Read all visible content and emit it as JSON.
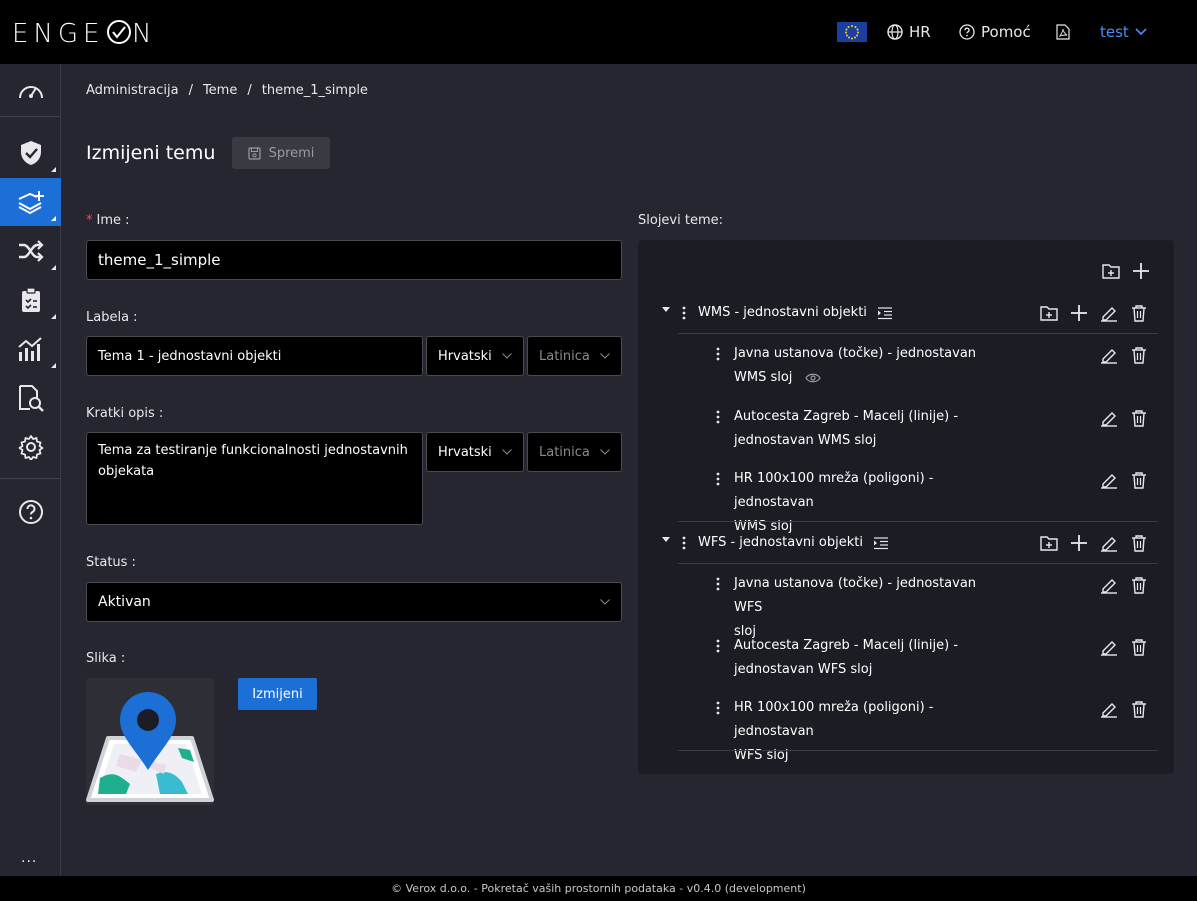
{
  "app": {
    "logo": "ENGE◯N"
  },
  "topbar": {
    "language": "HR",
    "help": "Pomoć",
    "user": "test"
  },
  "breadcrumb": {
    "items": [
      "Administracija",
      "Teme",
      "theme_1_simple"
    ],
    "separator": "/"
  },
  "page": {
    "title": "Izmijeni temu",
    "save_label": "Spremi"
  },
  "form": {
    "name_label": "Ime :",
    "name_required": "*",
    "name_value": "theme_1_simple",
    "label_label": "Labela :",
    "label_value": "Tema 1 - jednostavni objekti",
    "label_language": "Hrvatski",
    "label_script": "Latinica",
    "desc_label": "Kratki opis :",
    "desc_value": "Tema za testiranje funkcionalnosti jednostavnih objekata",
    "desc_language": "Hrvatski",
    "desc_script": "Latinica",
    "status_label": "Status :",
    "status_value": "Aktivan",
    "image_label": "Slika :",
    "image_change": "Izmijeni"
  },
  "layers": {
    "title": "Slojevi teme:",
    "groups": [
      {
        "title": "WMS - jednostavni objekti",
        "items": [
          {
            "line1": "Javna ustanova (točke) - jednostavan",
            "line2": "WMS sloj"
          },
          {
            "line1": "Autocesta Zagreb - Macelj (linije) -",
            "line2": "jednostavan WMS sloj"
          },
          {
            "line1": "HR 100x100 mreža (poligoni) - jednostavan",
            "line2": "WMS sloj"
          }
        ]
      },
      {
        "title": "WFS - jednostavni objekti",
        "items": [
          {
            "line1": "Javna ustanova (točke) - jednostavan WFS",
            "line2": "sloj"
          },
          {
            "line1": "Autocesta Zagreb - Macelj (linije) -",
            "line2": "jednostavan WFS sloj"
          },
          {
            "line1": "HR 100x100 mreža (poligoni) - jednostavan",
            "line2": "WFS sloj"
          }
        ]
      }
    ]
  },
  "sidebar": {
    "more": "..."
  },
  "footer": {
    "text": "© Verox d.o.o. - Pokretač vaših prostornih podataka - v0.4.0 (development)"
  }
}
